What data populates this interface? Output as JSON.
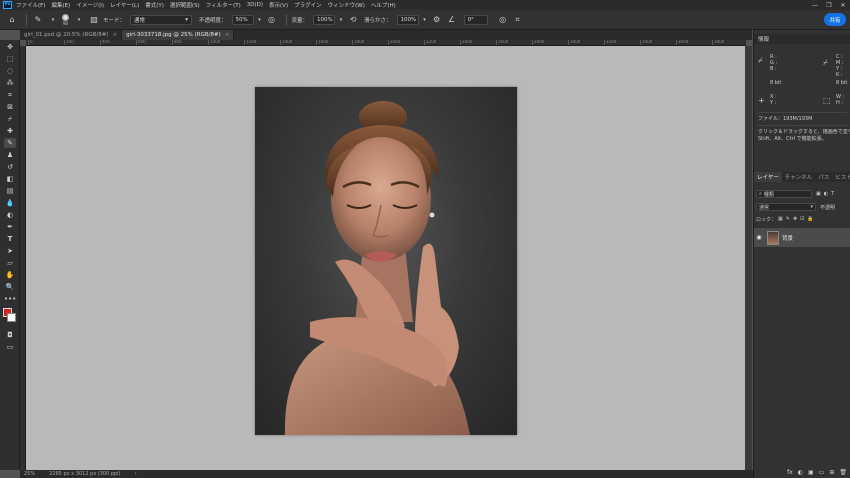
{
  "menubar": {
    "logo": "Ps",
    "items": [
      "ファイル(F)",
      "編集(E)",
      "イメージ(I)",
      "レイヤー(L)",
      "書式(Y)",
      "選択範囲(S)",
      "フィルター(T)",
      "3D(D)",
      "表示(V)",
      "プラグイン",
      "ウィンドウ(W)",
      "ヘルプ(H)"
    ],
    "window_controls": [
      "—",
      "❐",
      "✕"
    ]
  },
  "options": {
    "brush_size": "90",
    "mode_label": "モード：",
    "mode_value": "通常",
    "opacity_label": "不透明度：",
    "opacity_value": "50%",
    "flow_label": "流量：",
    "flow_value": "100%",
    "smoothing_label": "滑らかさ：",
    "smoothing_value": "100%",
    "angle_value": "0°",
    "share_label": "共有"
  },
  "tabs": [
    {
      "label": "girl_01.psd @ 20.5% (RGB/8#)",
      "close": "×",
      "active": false
    },
    {
      "label": "girl-3033718.jpg @ 25% (RGB/8#)",
      "close": "×",
      "active": true
    }
  ],
  "ruler": {
    "labels": [
      "0",
      "200",
      "400",
      "600",
      "800",
      "1000",
      "1200",
      "1400",
      "1600",
      "1800",
      "2000",
      "2200",
      "2400",
      "2600",
      "2800",
      "3000",
      "3200",
      "3400",
      "3600",
      "3800",
      "4000"
    ]
  },
  "status": {
    "zoom": "25%",
    "dimensions": "2265 px x 3012 px (300 ppi)",
    "arrow": "›"
  },
  "info_panel": {
    "title": "情報",
    "rgb": {
      "r": "R :",
      "g": "G :",
      "b": "B :",
      "bit": "8 bit"
    },
    "cmyk": {
      "c": "C :",
      "m": "M :",
      "y": "Y :",
      "k": "K :",
      "bit": "8 bit"
    },
    "xy": {
      "x": "X :",
      "y": "Y :"
    },
    "wh": {
      "w": "W :",
      "h": "H :"
    },
    "file": "ファイル：193M/193M",
    "hint1": "クリック＆ドラッグすると、描画色で塗りつぶ",
    "hint2": "Shift、Alt、Ctrl で機能拡張。"
  },
  "layers_panel": {
    "tabs": [
      "レイヤー",
      "チャンネル",
      "パス",
      "ヒストリー"
    ],
    "search_placeholder": "種類",
    "blend_mode": "通常",
    "opacity_label": "不透明",
    "lock_label": "ロック：",
    "layer_name": "背景",
    "bottom_icons": [
      "fx",
      "◐",
      "▣",
      "▭",
      "⊞",
      "🗑"
    ]
  }
}
